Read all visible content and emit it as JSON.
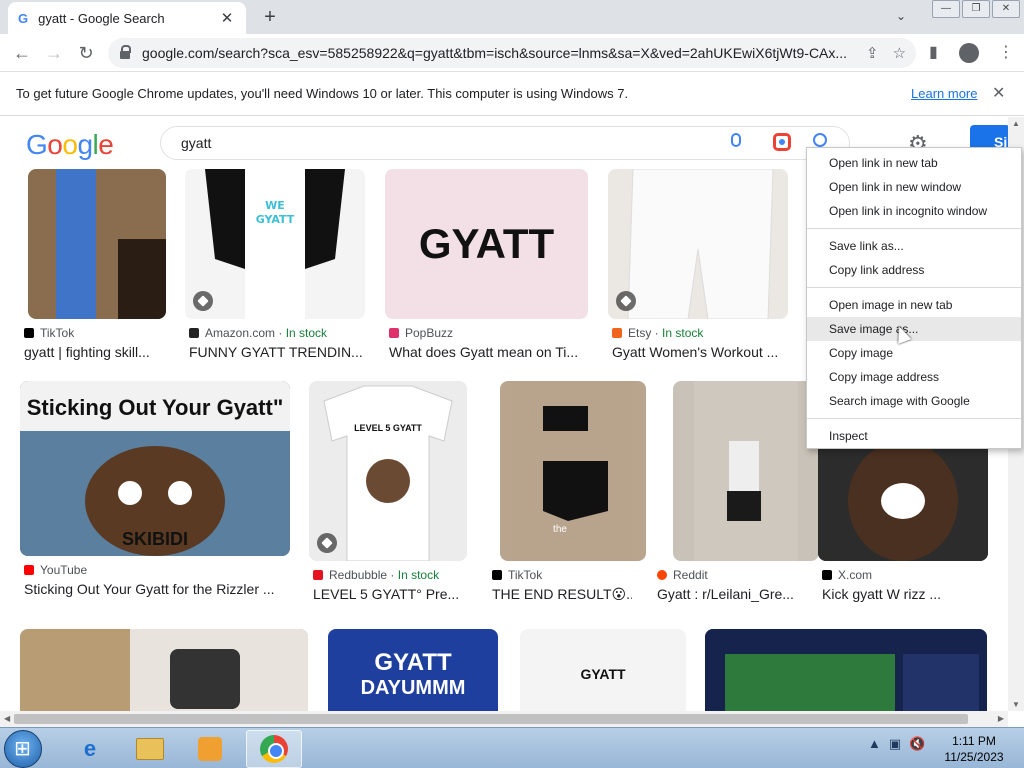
{
  "tab": {
    "title": "gyatt - Google Search",
    "favicon": "G"
  },
  "toolbar": {
    "url": "google.com/search?sca_esv=585258922&q=gyatt&tbm=isch&source=lnms&sa=X&ved=2ahUKEwiX6tjWt9-CAx..."
  },
  "infobar": {
    "message": "To get future Google Chrome updates, you'll need Windows 10 or later. This computer is using Windows 7.",
    "learn_more": "Learn more"
  },
  "search": {
    "logo_letters": [
      "G",
      "o",
      "o",
      "g",
      "l",
      "e"
    ],
    "query": "gyatt",
    "signin_label": "Si"
  },
  "results": [
    {
      "source": "TikTok",
      "stock": "",
      "caption": "gyatt | fighting skill...",
      "fav_color": "#000000",
      "img_text": "",
      "img_bg": "#8a6d4e"
    },
    {
      "source": "Amazon.com",
      "stock": "In stock",
      "caption": "FUNNY GYATT TRENDIN...",
      "fav_color": "#222222",
      "img_text": "",
      "img_bg": "#f0f0f0"
    },
    {
      "source": "PopBuzz",
      "stock": "",
      "caption": "What does Gyatt mean on Ti...",
      "fav_color": "#e0306b",
      "img_text": "GYATT",
      "img_bg": "#f3dfe6"
    },
    {
      "source": "Etsy",
      "stock": "In stock",
      "caption": "Gyatt Women's Workout ...",
      "fav_color": "#f1641e",
      "img_text": "",
      "img_bg": "#e8e4e0"
    },
    {
      "source": "YouTube",
      "stock": "",
      "caption": "Sticking Out Your Gyatt for the Rizzler ...",
      "fav_color": "#ff0000",
      "img_text": "Sticking Out Your Gyatt\"",
      "img_text2": "SKIBIDI",
      "img_bg": "#4a6e8e"
    },
    {
      "source": "Redbubble",
      "stock": "In stock",
      "caption": "LEVEL 5 GYATT° Pre...",
      "fav_color": "#e41321",
      "img_text": "LEVEL 5 GYATT",
      "img_bg": "#ececec"
    },
    {
      "source": "TikTok",
      "stock": "",
      "caption": "THE END RESULT😮...",
      "fav_color": "#000000",
      "img_text": "the",
      "img_bg": "#b9a48e"
    },
    {
      "source": "Reddit",
      "stock": "",
      "caption": "Gyatt : r/Leilani_Gre...",
      "fav_color": "#ff4500",
      "img_text": "",
      "img_bg": "#c9c2b8"
    },
    {
      "source": "X.com",
      "stock": "",
      "caption": "Kick gyatt W rizz ...",
      "fav_color": "#000000",
      "img_text": "",
      "img_bg": "#3b3b3b"
    },
    {
      "img_text": "",
      "img_bg": "#b89c74"
    },
    {
      "img_text": "GYATT",
      "img_text2": "DAYUMMM",
      "img_bg": "#1f3f9e"
    },
    {
      "img_text": "GYATT",
      "img_bg": "#f4f4f4"
    },
    {
      "img_text": "",
      "img_bg": "#1b2b5a"
    }
  ],
  "context_menu": [
    "Open link in new tab",
    "Open link in new window",
    "Open link in incognito window",
    "Save link as...",
    "Copy link address",
    "Open image in new tab",
    "Save image as...",
    "Copy image",
    "Copy image address",
    "Search image with Google",
    "Inspect"
  ],
  "clock": {
    "time": "1:11 PM",
    "date": "11/25/2023"
  }
}
